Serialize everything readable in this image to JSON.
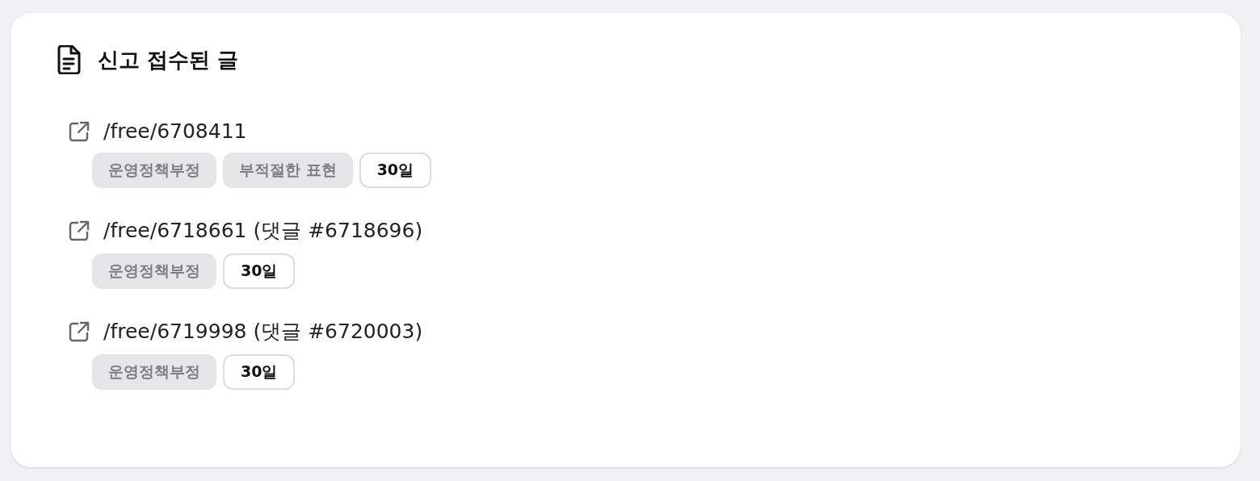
{
  "panel": {
    "title": "신고 접수된 글"
  },
  "reports": [
    {
      "link": "/free/6708411",
      "tags": [
        {
          "kind": "reason",
          "label": "운영정책부정"
        },
        {
          "kind": "reason",
          "label": "부적절한 표현"
        },
        {
          "kind": "duration",
          "label": "30일"
        }
      ]
    },
    {
      "link": "/free/6718661 (댓글 #6718696)",
      "tags": [
        {
          "kind": "reason",
          "label": "운영정책부정"
        },
        {
          "kind": "duration",
          "label": "30일"
        }
      ]
    },
    {
      "link": "/free/6719998 (댓글 #6720003)",
      "tags": [
        {
          "kind": "reason",
          "label": "운영정책부정"
        },
        {
          "kind": "duration",
          "label": "30일"
        }
      ]
    }
  ]
}
